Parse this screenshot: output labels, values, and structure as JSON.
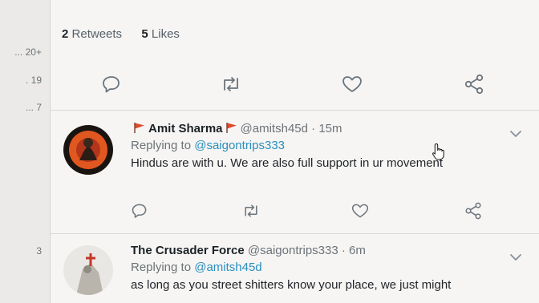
{
  "left_counts": [
    "... 20+",
    ". 19",
    "... 7",
    "3"
  ],
  "stats": {
    "retweets_count": "2",
    "retweets_label": "Retweets",
    "likes_count": "5",
    "likes_label": "Likes"
  },
  "tweets": [
    {
      "name": "Amit Sharma",
      "handle": "@amitsh45d",
      "sep": "·",
      "time": "15m",
      "replying_prefix": "Replying to",
      "replying_to": "@saigontrips333",
      "text": "Hindus are with u. We are also full support in ur movement"
    },
    {
      "name": "The Crusader Force",
      "handle": "@saigontrips333",
      "sep": "·",
      "time": "6m",
      "replying_prefix": "Replying to",
      "replying_to": "@amitsh45d",
      "text": "as long as you street shitters know your place, we just might"
    }
  ],
  "icons": {
    "reply": "reply-icon",
    "retweet": "retweet-icon",
    "like": "heart-icon",
    "share": "share-icon",
    "more": "chevron-down-icon",
    "flag": "flag-icon"
  },
  "colors": {
    "link": "#2a8fc0",
    "flag": "#e0472d",
    "icon": "#6b747c"
  }
}
